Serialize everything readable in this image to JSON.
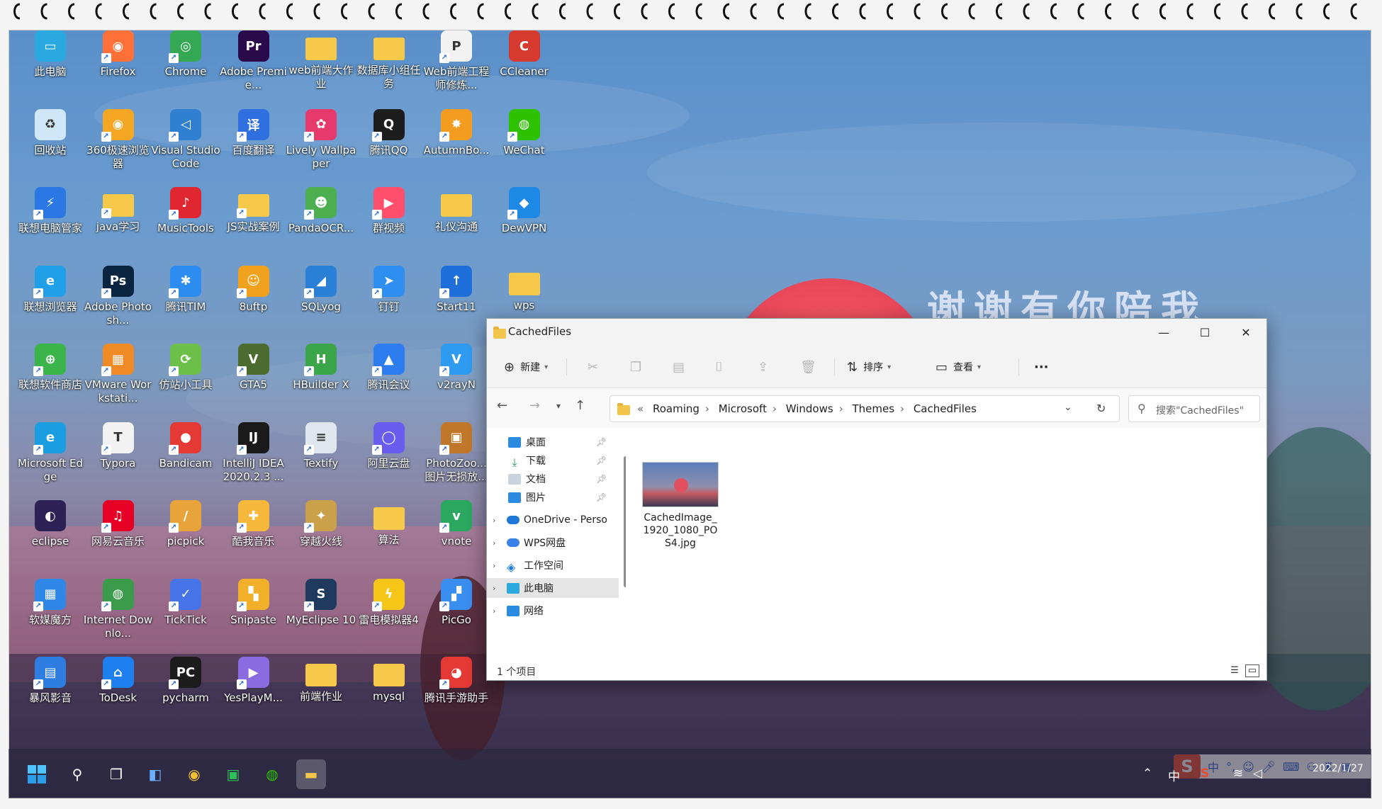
{
  "desktop": {
    "slogan": "谢谢有你陪我",
    "icons": [
      {
        "label": "此电脑",
        "col": 0,
        "row": 0,
        "color": "#2aa9e0",
        "glyph": "▭",
        "shortcut": false
      },
      {
        "label": "Firefox",
        "col": 1,
        "row": 0,
        "color": "#ff7139",
        "glyph": "◉",
        "shortcut": true
      },
      {
        "label": "Chrome",
        "col": 2,
        "row": 0,
        "color": "#34a853",
        "glyph": "◎",
        "shortcut": true
      },
      {
        "label": "Adobe Premie...",
        "col": 3,
        "row": 0,
        "color": "#2a0a4a",
        "glyph": "Pr",
        "shortcut": false
      },
      {
        "label": "web前端大作业",
        "col": 4,
        "row": 0,
        "color": "#f7c94a",
        "glyph": "",
        "shortcut": false
      },
      {
        "label": "数据库小组任务",
        "col": 5,
        "row": 0,
        "color": "#f7c94a",
        "glyph": "",
        "shortcut": false
      },
      {
        "label": "Web前端工程师修炼...",
        "col": 6,
        "row": 0,
        "color": "#f2f2f2",
        "glyph": "P",
        "shortcut": true
      },
      {
        "label": "CCleaner",
        "col": 7,
        "row": 0,
        "color": "#d63a2f",
        "glyph": "C",
        "shortcut": false
      },
      {
        "label": "回收站",
        "col": 0,
        "row": 1,
        "color": "#cfe7f7",
        "glyph": "♻",
        "shortcut": false
      },
      {
        "label": "360极速浏览器",
        "col": 1,
        "row": 1,
        "color": "#f5a623",
        "glyph": "◉",
        "shortcut": true
      },
      {
        "label": "Visual Studio Code",
        "col": 2,
        "row": 1,
        "color": "#2f80d0",
        "glyph": "◁",
        "shortcut": true
      },
      {
        "label": "百度翻译",
        "col": 3,
        "row": 1,
        "color": "#2f6fe0",
        "glyph": "译",
        "shortcut": true
      },
      {
        "label": "Lively Wallpaper",
        "col": 4,
        "row": 1,
        "color": "#e53a6b",
        "glyph": "✿",
        "shortcut": true
      },
      {
        "label": "腾讯QQ",
        "col": 5,
        "row": 1,
        "color": "#1d1d1d",
        "glyph": "Q",
        "shortcut": true
      },
      {
        "label": "AutumnBo...",
        "col": 6,
        "row": 1,
        "color": "#f39c1f",
        "glyph": "✸",
        "shortcut": true
      },
      {
        "label": "WeChat",
        "col": 7,
        "row": 1,
        "color": "#2dc100",
        "glyph": "◍",
        "shortcut": true
      },
      {
        "label": "联想电脑管家",
        "col": 0,
        "row": 2,
        "color": "#2b78e4",
        "glyph": "⚡",
        "shortcut": true
      },
      {
        "label": "java学习",
        "col": 1,
        "row": 2,
        "color": "#f7c94a",
        "glyph": "",
        "shortcut": true
      },
      {
        "label": "MusicTools",
        "col": 2,
        "row": 2,
        "color": "#e0262e",
        "glyph": "♪",
        "shortcut": true
      },
      {
        "label": "JS实战案例",
        "col": 3,
        "row": 2,
        "color": "#f7c94a",
        "glyph": "",
        "shortcut": true
      },
      {
        "label": "PandaOCR...",
        "col": 4,
        "row": 2,
        "color": "#4caf50",
        "glyph": "☻",
        "shortcut": true
      },
      {
        "label": "群视频",
        "col": 5,
        "row": 2,
        "color": "#ff4f6d",
        "glyph": "▶",
        "shortcut": true
      },
      {
        "label": "礼仪沟通",
        "col": 6,
        "row": 2,
        "color": "#f7c94a",
        "glyph": "",
        "shortcut": false
      },
      {
        "label": "DewVPN",
        "col": 7,
        "row": 2,
        "color": "#1e88e5",
        "glyph": "◆",
        "shortcut": true
      },
      {
        "label": "联想浏览器",
        "col": 0,
        "row": 3,
        "color": "#1fa0e8",
        "glyph": "e",
        "shortcut": true
      },
      {
        "label": "Adobe Photosh...",
        "col": 1,
        "row": 3,
        "color": "#0a2540",
        "glyph": "Ps",
        "shortcut": true
      },
      {
        "label": "腾讯TIM",
        "col": 2,
        "row": 3,
        "color": "#2d8cf0",
        "glyph": "✱",
        "shortcut": true
      },
      {
        "label": "8uftp",
        "col": 3,
        "row": 3,
        "color": "#f0a21e",
        "glyph": "☺",
        "shortcut": true
      },
      {
        "label": "SQLyog",
        "col": 4,
        "row": 3,
        "color": "#2a7fd6",
        "glyph": "◢",
        "shortcut": true
      },
      {
        "label": "钉钉",
        "col": 5,
        "row": 3,
        "color": "#2e8ff0",
        "glyph": "➤",
        "shortcut": true
      },
      {
        "label": "Start11",
        "col": 6,
        "row": 3,
        "color": "#1e6fd9",
        "glyph": "↑",
        "shortcut": true
      },
      {
        "label": "wps",
        "col": 7,
        "row": 3,
        "color": "#f7c94a",
        "glyph": "",
        "shortcut": false
      },
      {
        "label": "联想软件商店",
        "col": 0,
        "row": 4,
        "color": "#3bb54a",
        "glyph": "⊕",
        "shortcut": true
      },
      {
        "label": "VMware Workstati...",
        "col": 1,
        "row": 4,
        "color": "#f08a24",
        "glyph": "▦",
        "shortcut": true
      },
      {
        "label": "仿站小工具",
        "col": 2,
        "row": 4,
        "color": "#6cc04a",
        "glyph": "⟳",
        "shortcut": true
      },
      {
        "label": "GTA5",
        "col": 3,
        "row": 4,
        "color": "#4b6b2f",
        "glyph": "V",
        "shortcut": true
      },
      {
        "label": "HBuilder X",
        "col": 4,
        "row": 4,
        "color": "#3ba54a",
        "glyph": "H",
        "shortcut": true
      },
      {
        "label": "腾讯会议",
        "col": 5,
        "row": 4,
        "color": "#2d7cf0",
        "glyph": "▲",
        "shortcut": true
      },
      {
        "label": "v2rayN",
        "col": 6,
        "row": 4,
        "color": "#2e9bf0",
        "glyph": "V",
        "shortcut": true
      },
      {
        "label": "Microsoft Edge",
        "col": 0,
        "row": 5,
        "color": "#1b9de2",
        "glyph": "e",
        "shortcut": true
      },
      {
        "label": "Typora",
        "col": 1,
        "row": 5,
        "color": "#f2f2f2",
        "glyph": "T",
        "shortcut": true
      },
      {
        "label": "Bandicam",
        "col": 2,
        "row": 5,
        "color": "#e53935",
        "glyph": "●",
        "shortcut": true
      },
      {
        "label": "IntelliJ IDEA 2020.2.3 ...",
        "col": 3,
        "row": 5,
        "color": "#1a1a1a",
        "glyph": "IJ",
        "shortcut": true
      },
      {
        "label": "Textify",
        "col": 4,
        "row": 5,
        "color": "#dfe6ee",
        "glyph": "≡",
        "shortcut": true
      },
      {
        "label": "阿里云盘",
        "col": 5,
        "row": 5,
        "color": "#6b5cf0",
        "glyph": "◯",
        "shortcut": true
      },
      {
        "label": "PhotoZoo... 图片无损放...",
        "col": 6,
        "row": 5,
        "color": "#c0772a",
        "glyph": "▣",
        "shortcut": true
      },
      {
        "label": "eclipse",
        "col": 0,
        "row": 6,
        "color": "#2c2255",
        "glyph": "◐",
        "shortcut": false
      },
      {
        "label": "网易云音乐",
        "col": 1,
        "row": 6,
        "color": "#e60026",
        "glyph": "♫",
        "shortcut": true
      },
      {
        "label": "picpick",
        "col": 2,
        "row": 6,
        "color": "#e8a33a",
        "glyph": "/",
        "shortcut": true
      },
      {
        "label": "酷我音乐",
        "col": 3,
        "row": 6,
        "color": "#f6b83a",
        "glyph": "✚",
        "shortcut": true
      },
      {
        "label": "穿越火线",
        "col": 4,
        "row": 6,
        "color": "#caa04a",
        "glyph": "✦",
        "shortcut": true
      },
      {
        "label": "算法",
        "col": 5,
        "row": 6,
        "color": "#f7c94a",
        "glyph": "",
        "shortcut": false
      },
      {
        "label": "vnote",
        "col": 6,
        "row": 6,
        "color": "#2aa860",
        "glyph": "v",
        "shortcut": true
      },
      {
        "label": "软媒魔方",
        "col": 0,
        "row": 7,
        "color": "#2f88e8",
        "glyph": "▦",
        "shortcut": true
      },
      {
        "label": "Internet Downlo...",
        "col": 1,
        "row": 7,
        "color": "#3a9c4a",
        "glyph": "◍",
        "shortcut": true
      },
      {
        "label": "TickTick",
        "col": 2,
        "row": 7,
        "color": "#4774e8",
        "glyph": "✓",
        "shortcut": true
      },
      {
        "label": "Snipaste",
        "col": 3,
        "row": 7,
        "color": "#f2b02a",
        "glyph": "▚",
        "shortcut": true
      },
      {
        "label": "MyEclipse 10",
        "col": 4,
        "row": 7,
        "color": "#1f3a5e",
        "glyph": "S",
        "shortcut": true
      },
      {
        "label": "雷电模拟器4",
        "col": 5,
        "row": 7,
        "color": "#f5c518",
        "glyph": "ϟ",
        "shortcut": true
      },
      {
        "label": "PicGo",
        "col": 6,
        "row": 7,
        "color": "#3a8ef0",
        "glyph": "▞",
        "shortcut": true
      },
      {
        "label": "暴风影音",
        "col": 0,
        "row": 8,
        "color": "#2e7de0",
        "glyph": "▤",
        "shortcut": true
      },
      {
        "label": "ToDesk",
        "col": 1,
        "row": 8,
        "color": "#1e7ff0",
        "glyph": "⌂",
        "shortcut": true
      },
      {
        "label": "pycharm",
        "col": 2,
        "row": 8,
        "color": "#1c1c1c",
        "glyph": "PC",
        "shortcut": true
      },
      {
        "label": "YesPlayM...",
        "col": 3,
        "row": 8,
        "color": "#8a6ce0",
        "glyph": "▶",
        "shortcut": true
      },
      {
        "label": "前端作业",
        "col": 4,
        "row": 8,
        "color": "#f7c94a",
        "glyph": "",
        "shortcut": false
      },
      {
        "label": "mysql",
        "col": 5,
        "row": 8,
        "color": "#f7c94a",
        "glyph": "",
        "shortcut": false
      },
      {
        "label": "腾讯手游助手",
        "col": 6,
        "row": 8,
        "color": "#e53935",
        "glyph": "◕",
        "shortcut": true
      }
    ]
  },
  "explorer": {
    "title": "CachedFiles",
    "commands": {
      "new_label": "新建",
      "sort_label": "排序",
      "view_label": "查看",
      "more_label": "···"
    },
    "address": {
      "overflow": "«",
      "crumbs": [
        "Roaming",
        "Microsoft",
        "Windows",
        "Themes",
        "CachedFiles"
      ]
    },
    "search_placeholder": "搜索\"CachedFiles\"",
    "nav": {
      "quick": [
        {
          "label": "桌面",
          "color": "#2a8be0"
        },
        {
          "label": "下载",
          "color": "#2a9e5a"
        },
        {
          "label": "文档",
          "color": "#8aa0b8"
        },
        {
          "label": "图片",
          "color": "#2a8be0"
        }
      ],
      "onedrive": "OneDrive - Perso",
      "wps": "WPS网盘",
      "workspace": "工作空间",
      "thispc": "此电脑",
      "network": "网络"
    },
    "files": [
      {
        "name": "CachedImage_1920_1080_POS4.jpg"
      }
    ],
    "status": "1 个项目"
  },
  "ime": {
    "logo": "S",
    "mode": "中",
    "punct": "°,"
  },
  "tray": {
    "lang": "中",
    "time": "2022/1/27"
  }
}
